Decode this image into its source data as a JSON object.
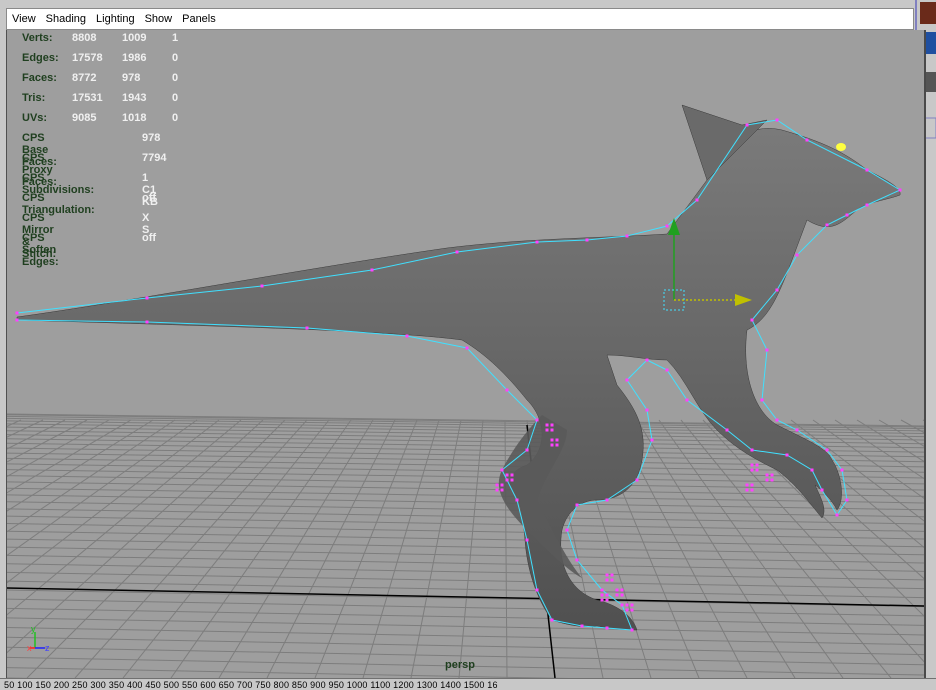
{
  "menu": {
    "items": [
      "View",
      "Shading",
      "Lighting",
      "Show",
      "Panels"
    ]
  },
  "hud": {
    "rows": [
      {
        "label": "Verts:",
        "v1": "8808",
        "v2": "1009",
        "v3": "1"
      },
      {
        "label": "Edges:",
        "v1": "17578",
        "v2": "1986",
        "v3": "0"
      },
      {
        "label": "Faces:",
        "v1": "8772",
        "v2": "978",
        "v3": "0"
      },
      {
        "label": "Tris:",
        "v1": "17531",
        "v2": "1943",
        "v3": "0"
      },
      {
        "label": "UVs:",
        "v1": "9085",
        "v2": "1018",
        "v3": "0"
      }
    ],
    "cps_rows": [
      {
        "label": "CPS Base Faces:",
        "value": "978"
      },
      {
        "label": "CPS Proxy Faces:",
        "value": "7794"
      },
      {
        "label": "CPS Subdivisions:",
        "value": "1 C1 KB"
      },
      {
        "label": "CPS Triangulation:",
        "value": "off"
      },
      {
        "label": "CPS Mirror & Stitch:",
        "value": "X S"
      },
      {
        "label": "CPS Soften Edges:",
        "value": "off"
      }
    ]
  },
  "viewport": {
    "camera_label": "persp",
    "background_color": "#9e9e9e",
    "grid_color": "#7a7a7a",
    "model_color": "#6a6a6a",
    "cage_color": "#40e0ff",
    "vertex_color": "#ff40ff"
  },
  "axis": {
    "y": "y",
    "x": "x",
    "z": "z"
  },
  "ruler": {
    "text": "50  100  150  200  250  300  350  400  450  500  550  600  650  700  750  800  850  900  950  1000     1100     1200     1300     1400     1500     16"
  }
}
